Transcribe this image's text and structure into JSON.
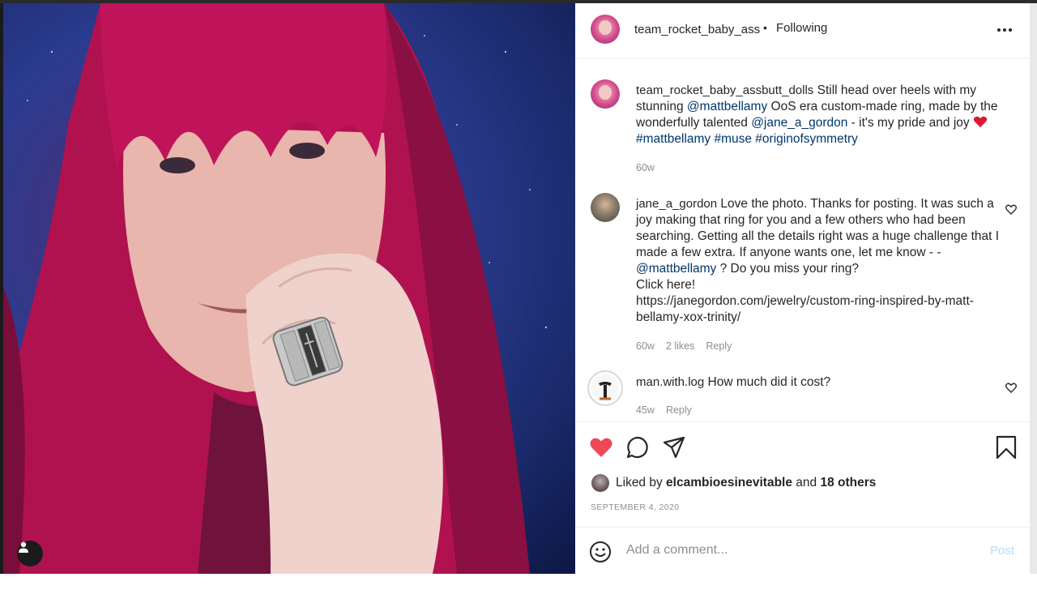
{
  "post": {
    "owner_username": "team_rocket_baby_ass",
    "separator": "•",
    "follow_status": "Following",
    "more_icon": "more-horizontal-icon"
  },
  "caption": {
    "username": "team_rocket_baby_assbutt_dolls",
    "text_1": "Still head over heels with my stunning",
    "mention_1": "@mattbellamy",
    "text_2": "OoS era custom-made ring, made by the wonderfully talented",
    "mention_2": "@jane_a_gordon",
    "text_3": "- it's my pride and joy",
    "hashtags": "#mattbellamy #muse #originofsymmetry",
    "age": "60w"
  },
  "comments": [
    {
      "username": "jane_a_gordon",
      "text_1": "Love the photo. Thanks for posting. It was such a joy making that ring for you and a few others who had been searching. Getting all the details right was a huge challenge that I made a few extra. If anyone wants one, let me know - -",
      "mention": "@mattbellamy",
      "text_2": "? Do you miss your ring?",
      "text_3": "Click here!",
      "text_4": "https://janegordon.com/jewelry/custom-ring-inspired-by-matt-bellamy-xox-trinity/",
      "age": "60w",
      "likes": "2 likes",
      "reply": "Reply"
    },
    {
      "username": "man.with.log",
      "text": "How much did it cost?",
      "age": "45w",
      "reply": "Reply"
    }
  ],
  "likes": {
    "prefix": "Liked by",
    "user": "elcambioesinevitable",
    "conj": "and",
    "others": "18 others"
  },
  "date": "SEPTEMBER 4, 2020",
  "add_comment": {
    "placeholder": "Add a comment...",
    "post_label": "Post"
  },
  "colors": {
    "like_red": "#ed4956",
    "link_blue": "#00376b",
    "post_disabled": "#b2dffc"
  }
}
